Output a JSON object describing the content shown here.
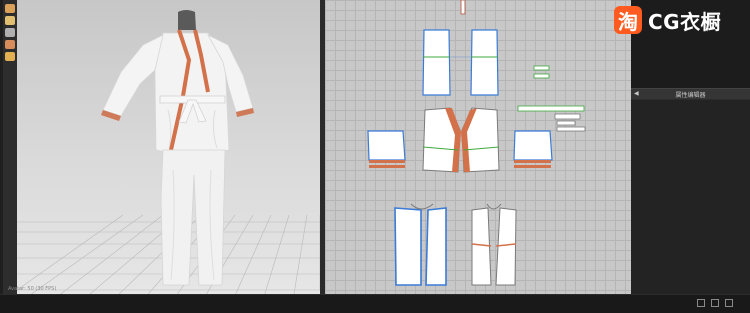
{
  "viewport3d": {
    "status_text": "Avatar: 50 (30 FPS)",
    "tools": [
      {
        "icon": "move-icon",
        "color": "#d9a15a"
      },
      {
        "icon": "select-icon",
        "color": "#e0c070"
      },
      {
        "icon": "pencil-icon",
        "color": "#b0b0b0"
      },
      {
        "icon": "hand-icon",
        "color": "#d88c5a"
      },
      {
        "icon": "stack-icon",
        "color": "#e2b052"
      }
    ]
  },
  "property_panel": {
    "title": "属性编辑器",
    "collapse_glyph": "◀"
  },
  "watermark": {
    "badge": "淘",
    "text": "CG衣橱"
  },
  "statusbar": {
    "buttons": [
      "view-single-icon",
      "view-split-icon",
      "view-full-icon"
    ]
  },
  "colors": {
    "seam_blue": "#3c7bd6",
    "seam_green": "#3da93d",
    "trim_orange": "#d2714a",
    "piece_fill": "#ffffff"
  }
}
